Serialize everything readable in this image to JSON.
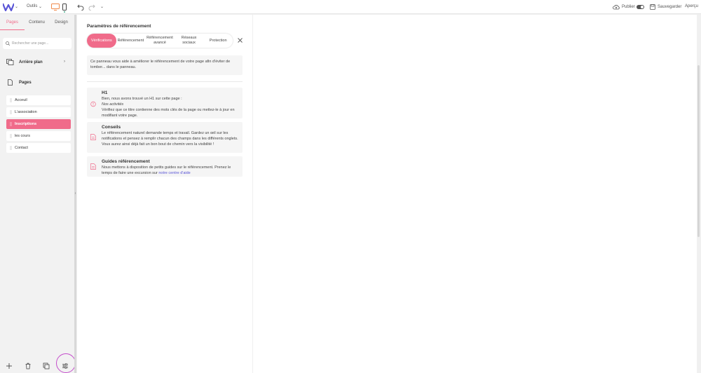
{
  "topbar": {
    "tools_label": "Outils",
    "publish_label": "Publier",
    "save_label": "Sauvegarder",
    "preview_label": "Aperçu"
  },
  "sidebar": {
    "tabs": [
      "Pages",
      "Contenu",
      "Design"
    ],
    "active_tab": "Pages",
    "search_placeholder": "Rechercher une page...",
    "background_label": "Arrière plan",
    "pages_label": "Pages",
    "pages": [
      "Acceuil",
      "L'association",
      "Inscriptions",
      "les cours",
      "Contact"
    ],
    "active_page": "Inscriptions"
  },
  "panel": {
    "title": "Paramètres de référencement",
    "tabs": [
      "Vérifications",
      "Référencement",
      "Référencement avancé",
      "Réseaux sociaux",
      "Protection"
    ],
    "active_tab": "Vérifications",
    "intro": "Ce panneau vous aide à améliorer le référencement de votre page afin d'éviter de tomber... dans le panneau.",
    "cards": [
      {
        "title": "H1",
        "line1": "Bien, nous avons trouvé un H1 sur cette page :",
        "italic": "Nos activités",
        "line2": "Vérifiez que ce titre contienne des mots clés de la page ou mettez-le à jour en modifiant votre page."
      },
      {
        "title": "Conseils",
        "line1": "Le référencement naturel demande temps et travail. Gardez un œil sur les notifications et pensez à remplir chacun des champs dans les différents onglets.",
        "line2": "Vous aurez ainsi déjà fait un bon bout de chemin vers la visibilité !"
      },
      {
        "title": "Guides référencement",
        "line1": "Nous mettons à disposition de petits guides sur le référencement. Prenez le temps de faire une excursion sur",
        "link": "notre centre d'aide"
      }
    ]
  },
  "colors": {
    "accent": "#f06b8a",
    "link": "#5a55d6",
    "highlight_ring": "#c44dcb"
  }
}
